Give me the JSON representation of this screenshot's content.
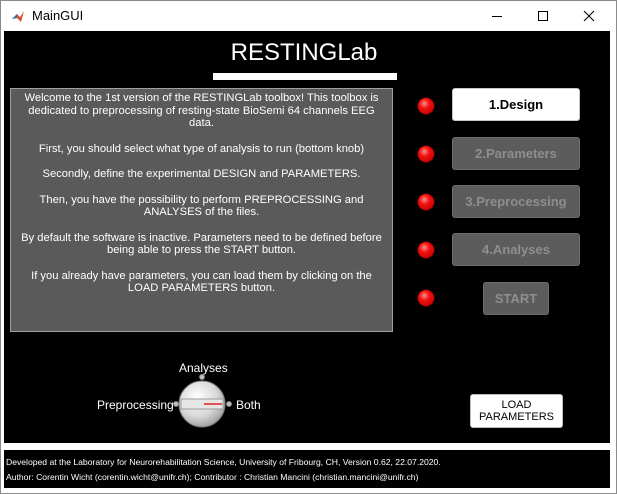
{
  "window": {
    "title": "MainGUI",
    "controls": [
      "minimize-icon",
      "maximize-icon",
      "close-icon"
    ]
  },
  "app": {
    "title": "RESTINGLab"
  },
  "welcome": {
    "paragraphs": [
      "Welcome to the 1st version of the RESTINGLab toolbox! This toolbox is dedicated to preprocessing of resting-state BioSemi 64 channels EEG data.",
      "First, you should select what type of analysis to run (bottom knob)",
      "Secondly, define the experimental DESIGN and PARAMETERS.",
      "Then, you have the possibility to perform PREPROCESSING and ANALYSES of the files.",
      "By default the software is inactive. Parameters need to be defined before being able to press the START button.",
      "If you already have parameters, you can load them by clicking on the LOAD PARAMETERS button."
    ]
  },
  "steps": [
    {
      "label": "1.Design",
      "status": "active",
      "led": "red"
    },
    {
      "label": "2.Parameters",
      "status": "inactive",
      "led": "red"
    },
    {
      "label": "3.Preprocessing",
      "status": "inactive",
      "led": "red"
    },
    {
      "label": "4.Analyses",
      "status": "inactive",
      "led": "red"
    },
    {
      "label": "START",
      "status": "inactive",
      "led": "red"
    }
  ],
  "knob": {
    "options": {
      "top": "Analyses",
      "left": "Preprocessing",
      "right": "Both"
    },
    "selected": "Both"
  },
  "load_button": {
    "line1": "LOAD",
    "line2": "PARAMETERS"
  },
  "footer": {
    "line1": "Developed at the Laboratory for Neurorehabilitation Science, University of Fribourg, CH, Version 0.62, 22.07.2020.",
    "line2": "Author: Corentin Wicht (corentin.wicht@unifr.ch); Contributor : Christian Mancini (christian.mancini@unifr.ch)"
  },
  "colors": {
    "background": "#000000",
    "panel": "#5a5a5a",
    "led": "#f01010",
    "active_button": "#ffffff",
    "inactive_button": "#5c5c5c",
    "inactive_text": "#8e8e8e"
  }
}
